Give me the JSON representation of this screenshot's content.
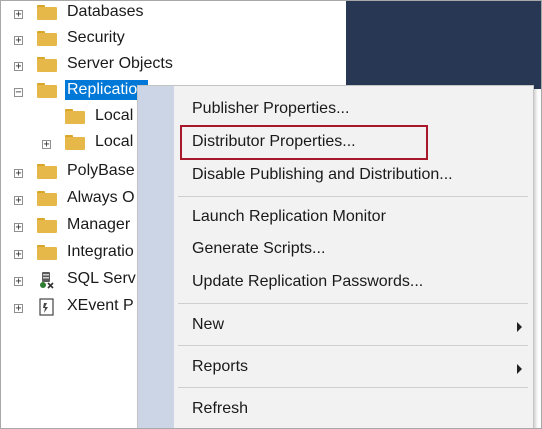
{
  "tree": {
    "items": [
      {
        "label": "Databases",
        "expander": "+",
        "icon": "folder-icon"
      },
      {
        "label": "Security",
        "expander": "+",
        "icon": "folder-icon"
      },
      {
        "label": "Server Objects",
        "expander": "+",
        "icon": "folder-icon"
      },
      {
        "label": "Replication",
        "expander": "−",
        "icon": "folder-icon",
        "selected": true
      },
      {
        "label": "Local",
        "expander": "",
        "icon": "folder-icon"
      },
      {
        "label": "Local",
        "expander": "+",
        "icon": "folder-icon"
      },
      {
        "label": "PolyBase",
        "expander": "+",
        "icon": "folder-icon"
      },
      {
        "label": "Always O",
        "expander": "+",
        "icon": "folder-icon"
      },
      {
        "label": "Manager",
        "expander": "+",
        "icon": "folder-icon"
      },
      {
        "label": "Integratio",
        "expander": "+",
        "icon": "folder-icon"
      },
      {
        "label": "SQL Serv",
        "expander": "+",
        "icon": "sql-agent-icon"
      },
      {
        "label": "XEvent P",
        "expander": "+",
        "icon": "xevent-icon"
      }
    ]
  },
  "context_menu": {
    "items": [
      {
        "label": "Publisher Properties..."
      },
      {
        "label": "Distributor Properties...",
        "highlighted": true
      },
      {
        "label": "Disable Publishing and Distribution..."
      },
      {
        "label": "Launch Replication Monitor"
      },
      {
        "label": "Generate Scripts..."
      },
      {
        "label": "Update Replication Passwords..."
      },
      {
        "label": "New",
        "submenu": true
      },
      {
        "label": "Reports",
        "submenu": true
      },
      {
        "label": "Refresh"
      }
    ]
  },
  "colors": {
    "selection": "#0078d7",
    "highlight_box": "#a8182a",
    "menu_gutter": "#cbd5e6",
    "dark_pane": "#283754",
    "folder": "#e6b84a"
  }
}
